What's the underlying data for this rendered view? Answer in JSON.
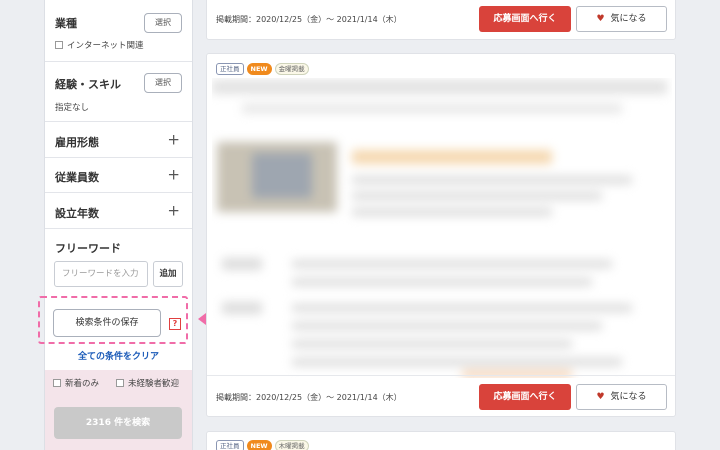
{
  "sidebar": {
    "industry": {
      "title": "業種",
      "select_label": "選択",
      "internet_label": "インターネット関連"
    },
    "experience": {
      "title": "経験・スキル",
      "select_label": "選択",
      "value": "指定なし"
    },
    "employment_type": {
      "title": "雇用形態"
    },
    "employees": {
      "title": "従業員数"
    },
    "founded": {
      "title": "設立年数"
    },
    "freeword": {
      "title": "フリーワード",
      "placeholder": "フリーワードを入力",
      "add_label": "追加"
    },
    "save_label": "検索条件の保存",
    "help_icon": "?",
    "clear_label": "全ての条件をクリア",
    "options": {
      "new_only": "新着のみ",
      "no_experience": "未経験者歓迎"
    },
    "search_label": "2316 件を検索"
  },
  "cards": [
    {
      "period": "掲載期間：2020/12/25（金）～ 2021/1/14（木）",
      "apply_label": "応募画面へ行く",
      "fav_label": "気になる"
    },
    {
      "tags": {
        "employment": "正社員",
        "new": "NEW",
        "day": "金曜掲載"
      },
      "period": "掲載期間：2020/12/25（金）～ 2021/1/14（木）",
      "apply_label": "応募画面へ行く",
      "fav_label": "気になる"
    },
    {
      "tags": {
        "employment": "正社員",
        "new": "NEW",
        "day": "木曜掲載"
      }
    }
  ],
  "colors": {
    "accent_red": "#d9433b",
    "highlight_pink": "#f06ca8",
    "link_blue": "#1a5ab8",
    "new_orange": "#f08a1d"
  }
}
